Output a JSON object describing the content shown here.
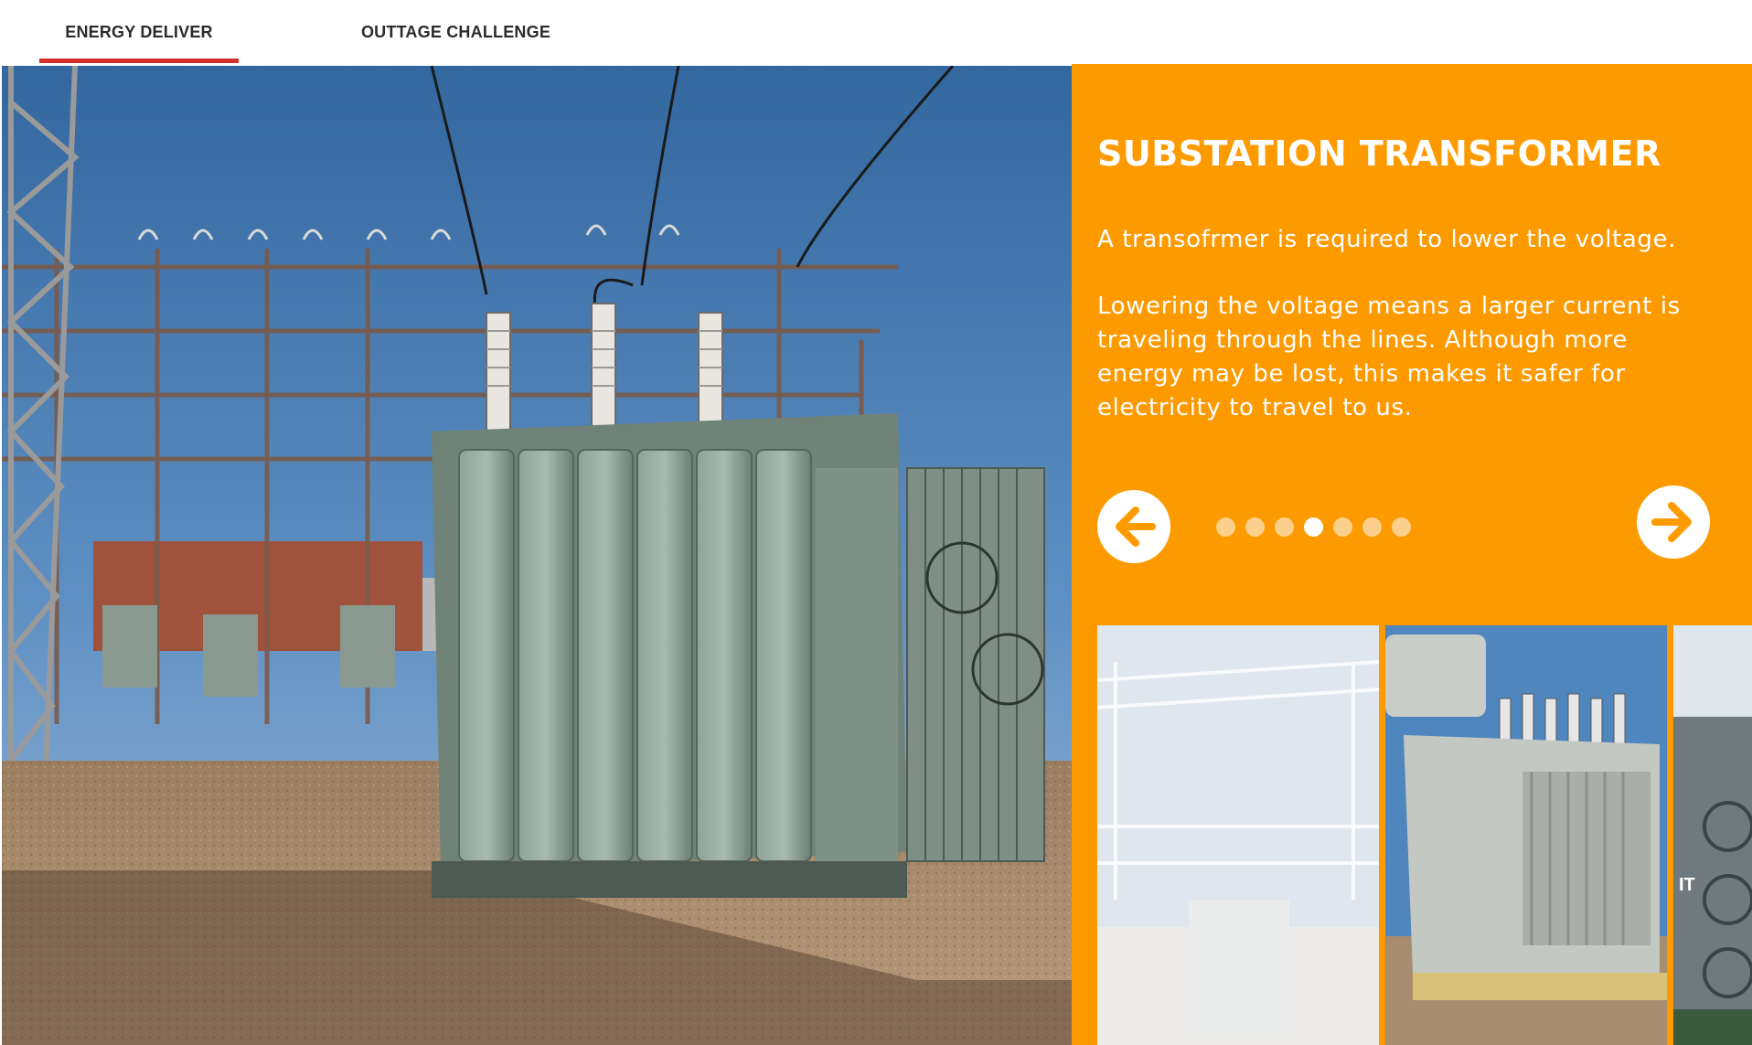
{
  "tabs": [
    {
      "label": "ENERGY DELIVER",
      "active": true
    },
    {
      "label": "OUTTAGE CHALLENGE",
      "active": false
    }
  ],
  "main_image": {
    "alt": "substation-transformer-photo"
  },
  "panel": {
    "title": "SUBSTATION TRANSFORMER",
    "paragraph1": "A transofrmer is required to lower the voltage.",
    "paragraph2": "Lowering the voltage means a larger current is traveling through the lines. Although more energy may be lost, this makes it safer for electricity to travel to us.",
    "dots_total": 7,
    "dots_active_index": 3,
    "prev_icon": "arrow-left-icon",
    "next_icon": "arrow-right-icon",
    "thumb3_caption": "IT"
  },
  "colors": {
    "accent": "#fd9a00",
    "tab_underline": "#d32f2f",
    "dot_inactive": "#fdcf8c",
    "dot_active": "#ffffff"
  }
}
